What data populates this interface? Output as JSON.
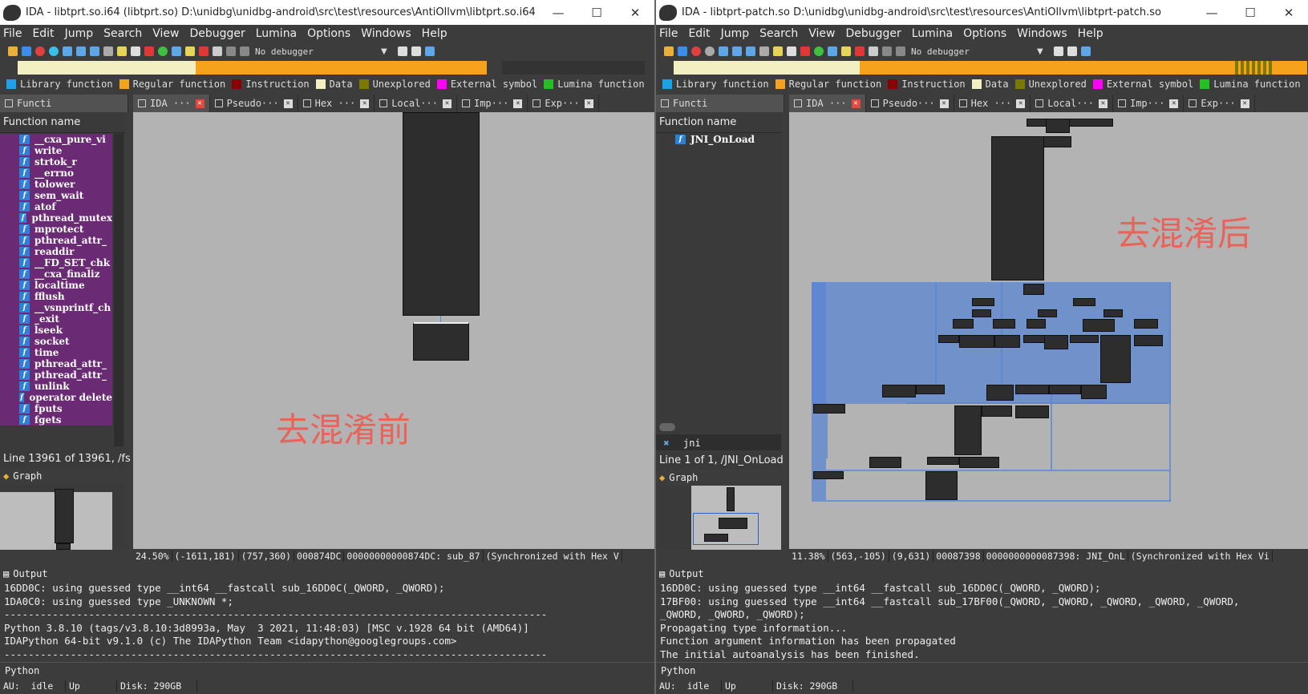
{
  "left": {
    "title": "IDA - libtprt.so.i64 (libtprt.so) D:\\unidbg\\unidbg-android\\src\\test\\resources\\AntiOllvm\\libtprt.so.i64",
    "debugger": "No debugger",
    "func_panel_title": "Functi",
    "function_name_header": "Function name",
    "functions": [
      "__cxa_pure_vi",
      "write",
      "strtok_r",
      "__errno",
      "tolower",
      "sem_wait",
      "atof",
      "pthread_mutex",
      "mprotect",
      "pthread_attr_",
      "readdir",
      "__FD_SET_chk",
      "__cxa_finaliz",
      "localtime",
      "fflush",
      "__vsnprintf_ch",
      "_exit",
      "lseek",
      "socket",
      "time",
      "pthread_attr_",
      "pthread_attr_",
      "unlink",
      "operator delete",
      "fputs",
      "fgets"
    ],
    "line_info": "Line 13961 of 13961, /fs",
    "graph_label": "Graph",
    "tabs": [
      "IDA ···",
      "Pseudo···",
      "Hex ···",
      "Local···",
      "Imp···",
      "Exp···"
    ],
    "status": [
      "24.50%",
      "(-1611,181)",
      "(757,360)",
      "000874DC",
      "00000000000874DC: sub_87",
      "(Synchronized with Hex V"
    ],
    "overlay_text": "去混淆前",
    "output_title": "Output",
    "output_lines": [
      "16DD0C: using guessed type __int64 __fastcall sub_16DD0C(_QWORD, _QWORD);",
      "1DA0C0: using guessed type _UNKNOWN *;",
      "------------------------------------------------------------------------------------------",
      "Python 3.8.10 (tags/v3.8.10:3d8993a, May  3 2021, 11:48:03) [MSC v.1928 64 bit (AMD64)]",
      "IDAPython 64-bit v9.1.0 (c) The IDAPython Team <idapython@googlegroups.com>",
      "------------------------------------------------------------------------------------------"
    ],
    "python_label": "Python",
    "bottom": [
      "AU:  idle",
      "Up",
      "Disk: 290GB"
    ]
  },
  "right": {
    "title": "IDA - libtprt-patch.so D:\\unidbg\\unidbg-android\\src\\test\\resources\\AntiOllvm\\libtprt-patch.so",
    "debugger": "No debugger",
    "func_panel_title": "Functi",
    "function_name_header": "Function name",
    "functions": [
      "JNI_OnLoad"
    ],
    "filter_text": "jni",
    "line_info": "Line 1 of 1, /JNI_OnLoad",
    "graph_label": "Graph",
    "tabs": [
      "IDA ···",
      "Pseudo···",
      "Hex ···",
      "Local···",
      "Imp···",
      "Exp···"
    ],
    "status": [
      "11.38%",
      "(563,-105)",
      "(9,631)",
      "00087398",
      "0000000000087398: JNI_OnL",
      "(Synchronized with Hex Vi"
    ],
    "overlay_text": "去混淆后",
    "output_title": "Output",
    "output_lines": [
      "16DD0C: using guessed type __int64 __fastcall sub_16DD0C(_QWORD, _QWORD);",
      "17BF00: using guessed type __int64 __fastcall sub_17BF00(_QWORD, _QWORD, _QWORD, _QWORD, _QWORD,",
      "_QWORD, _QWORD, _QWORD);",
      "Propagating type information...",
      "Function argument information has been propagated",
      "The initial autoanalysis has been finished."
    ],
    "python_label": "Python",
    "bottom": [
      "AU:  idle",
      "Up",
      "Disk: 290GB"
    ]
  },
  "menu": [
    "File",
    "Edit",
    "Jump",
    "Search",
    "View",
    "Debugger",
    "Lumina",
    "Options",
    "Windows",
    "Help"
  ],
  "legend": [
    {
      "label": "Library function",
      "color": "#1aa3e8"
    },
    {
      "label": "Regular function",
      "color": "#f7a21b"
    },
    {
      "label": "Instruction",
      "color": "#8b0000"
    },
    {
      "label": "Data",
      "color": "#f2f0c2"
    },
    {
      "label": "Unexplored",
      "color": "#7a7a00"
    },
    {
      "label": "External symbol",
      "color": "#ff00ff"
    },
    {
      "label": "Lumina function",
      "color": "#22c022"
    }
  ],
  "colors": {
    "graph_bg": "#b3b3b3",
    "block": "#2d2d2d",
    "edge": "#5b86d1",
    "lib_highlight": "#6b2a74",
    "overlay": "#e8645b"
  }
}
